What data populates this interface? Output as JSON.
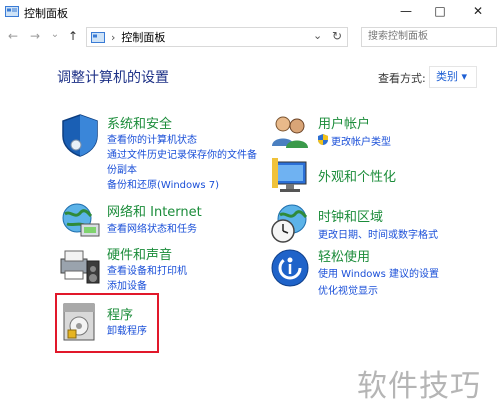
{
  "window": {
    "title": "控制面板"
  },
  "controls": {
    "minimize": "—",
    "maximize": "□",
    "close": "✕"
  },
  "nav": {
    "back": "←",
    "forward": "→",
    "recent": "⌄",
    "up": "↑",
    "chevron": "›",
    "dropdown": "⌄",
    "refresh": "↻"
  },
  "address": {
    "path": "控制面板"
  },
  "search": {
    "placeholder": "搜索控制面板"
  },
  "heading": "调整计算机的设置",
  "view_by": {
    "label": "查看方式:",
    "value": "类别 ▾"
  },
  "categories": {
    "system_security": {
      "title": "系统和安全",
      "links": [
        "查看你的计算机状态",
        "通过文件历史记录保存你的文件备",
        "份副本",
        "备份和还原(Windows 7)"
      ]
    },
    "network": {
      "title": "网络和 Internet",
      "links": [
        "查看网络状态和任务"
      ]
    },
    "hardware": {
      "title": "硬件和声音",
      "links": [
        "查看设备和打印机",
        "添加设备"
      ]
    },
    "programs": {
      "title": "程序",
      "links": [
        "卸载程序"
      ]
    },
    "user_accounts": {
      "title": "用户帐户",
      "links": [
        "更改帐户类型"
      ]
    },
    "appearance": {
      "title": "外观和个性化",
      "links": []
    },
    "clock_region": {
      "title": "时钟和区域",
      "links": [
        "更改日期、时间或数字格式"
      ]
    },
    "ease": {
      "title": "轻松使用",
      "links": [
        "使用 Windows 建议的设置",
        "优化视觉显示"
      ]
    }
  },
  "watermark": "软件技巧",
  "colors": {
    "heading": "#1e3287",
    "category": "#1b8c3a",
    "link": "#1a4fd8",
    "highlight": "#e1182a"
  }
}
